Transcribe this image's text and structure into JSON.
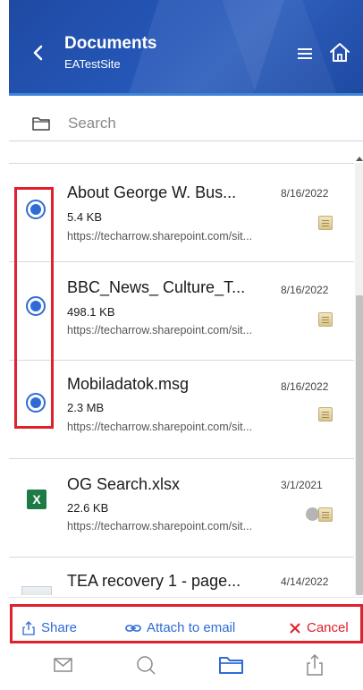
{
  "header": {
    "title": "Documents",
    "subtitle": "EATestSite"
  },
  "search": {
    "placeholder": "Search"
  },
  "files": [
    {
      "name": "About George W. Bus...",
      "size": "5.4 KB",
      "url": "https://techarrow.sharepoint.com/sit...",
      "date": "8/16/2022",
      "selected": true,
      "icon": "doc-icon"
    },
    {
      "name": "BBC_News_ Culture_T...",
      "size": "498.1 KB",
      "url": "https://techarrow.sharepoint.com/sit...",
      "date": "8/16/2022",
      "selected": true,
      "icon": "doc-icon"
    },
    {
      "name": "Mobiladatok.msg",
      "size": "2.3 MB",
      "url": "https://techarrow.sharepoint.com/sit...",
      "date": "8/16/2022",
      "selected": true,
      "icon": "doc-icon"
    },
    {
      "name": "OG Search.xlsx",
      "size": "22.6 KB",
      "url": "https://techarrow.sharepoint.com/sit...",
      "date": "3/1/2021",
      "selected": false,
      "icon": "excel-icon"
    },
    {
      "name": "TEA recovery 1 - page...",
      "size": "",
      "url": "",
      "date": "4/14/2022",
      "selected": false,
      "icon": "image-thumbnail"
    }
  ],
  "actions": {
    "share": "Share",
    "attach": "Attach to email",
    "cancel": "Cancel"
  },
  "nav": [
    "mail-icon",
    "search-icon",
    "folder-icon",
    "share-icon"
  ],
  "colors": {
    "header": "#2557b8",
    "accent": "#2f6bd6",
    "cancel": "#e0202c",
    "highlight": "#e0202c",
    "excel": "#1e7b45"
  }
}
